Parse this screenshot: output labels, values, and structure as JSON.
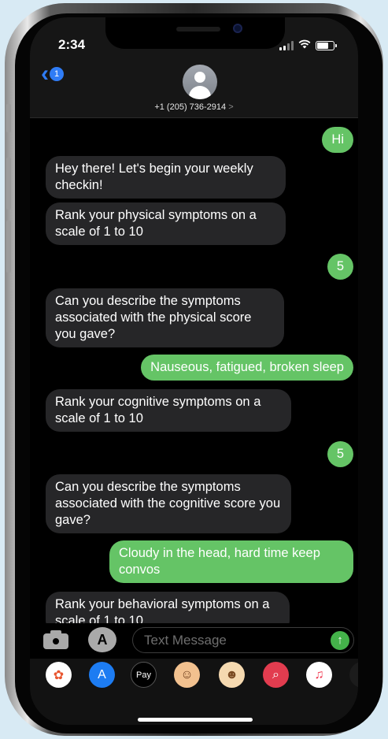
{
  "status_bar": {
    "time": "2:34"
  },
  "header": {
    "back_badge": "1",
    "contact_number": "+1 (205) 736-2914",
    "contact_chevron": ">"
  },
  "messages": [
    {
      "direction": "out",
      "text": "Hi"
    },
    {
      "direction": "in",
      "text": "Hey there! Let's begin your weekly checkin!"
    },
    {
      "direction": "in",
      "text": "Rank your physical symptoms on a scale of 1 to 10"
    },
    {
      "direction": "out",
      "text": "5"
    },
    {
      "direction": "in",
      "text": "Can you describe the symptoms associated with the physical score you gave?"
    },
    {
      "direction": "out",
      "text": "Nauseous, fatigued, broken sleep"
    },
    {
      "direction": "in",
      "text": "Rank your cognitive symptoms on a scale of 1 to 10"
    },
    {
      "direction": "out",
      "text": "5"
    },
    {
      "direction": "in",
      "text": "Can you describe the symptoms associated with the cognitive score you gave?"
    },
    {
      "direction": "out",
      "text": "Cloudy in the head, hard time keep convos"
    },
    {
      "direction": "in",
      "text": "Rank your behavioral symptoms on a scale of 1 to 10"
    }
  ],
  "composer": {
    "placeholder": "Text Message",
    "send_glyph": "↑"
  },
  "app_tray": [
    {
      "name": "photos-app-icon",
      "glyph": "✿",
      "bg": "#ffffff",
      "fg": "#e8552f"
    },
    {
      "name": "app-store-icon",
      "glyph": "A",
      "bg": "#1d7cf2",
      "fg": "#ffffff"
    },
    {
      "name": "apple-pay-icon",
      "glyph": "Pay",
      "bg": "#000000",
      "fg": "#ffffff"
    },
    {
      "name": "memoji-icon",
      "glyph": "☺",
      "bg": "#f2c18f",
      "fg": "#6b3b1a"
    },
    {
      "name": "animoji-monkey-icon",
      "glyph": "☻",
      "bg": "#f5d9b0",
      "fg": "#7a4a22"
    },
    {
      "name": "image-search-icon",
      "glyph": "⌕",
      "bg": "#e23c4f",
      "fg": "#ffffff"
    },
    {
      "name": "music-app-icon",
      "glyph": "♫",
      "bg": "#ffffff",
      "fg": "#f0334b"
    },
    {
      "name": "digital-touch-icon",
      "glyph": "♥",
      "bg": "#1c1c1c",
      "fg": "#f0334b"
    }
  ],
  "colors": {
    "incoming_bubble": "#262628",
    "outgoing_bubble": "#65c466",
    "link_blue": "#2f7cf6"
  }
}
